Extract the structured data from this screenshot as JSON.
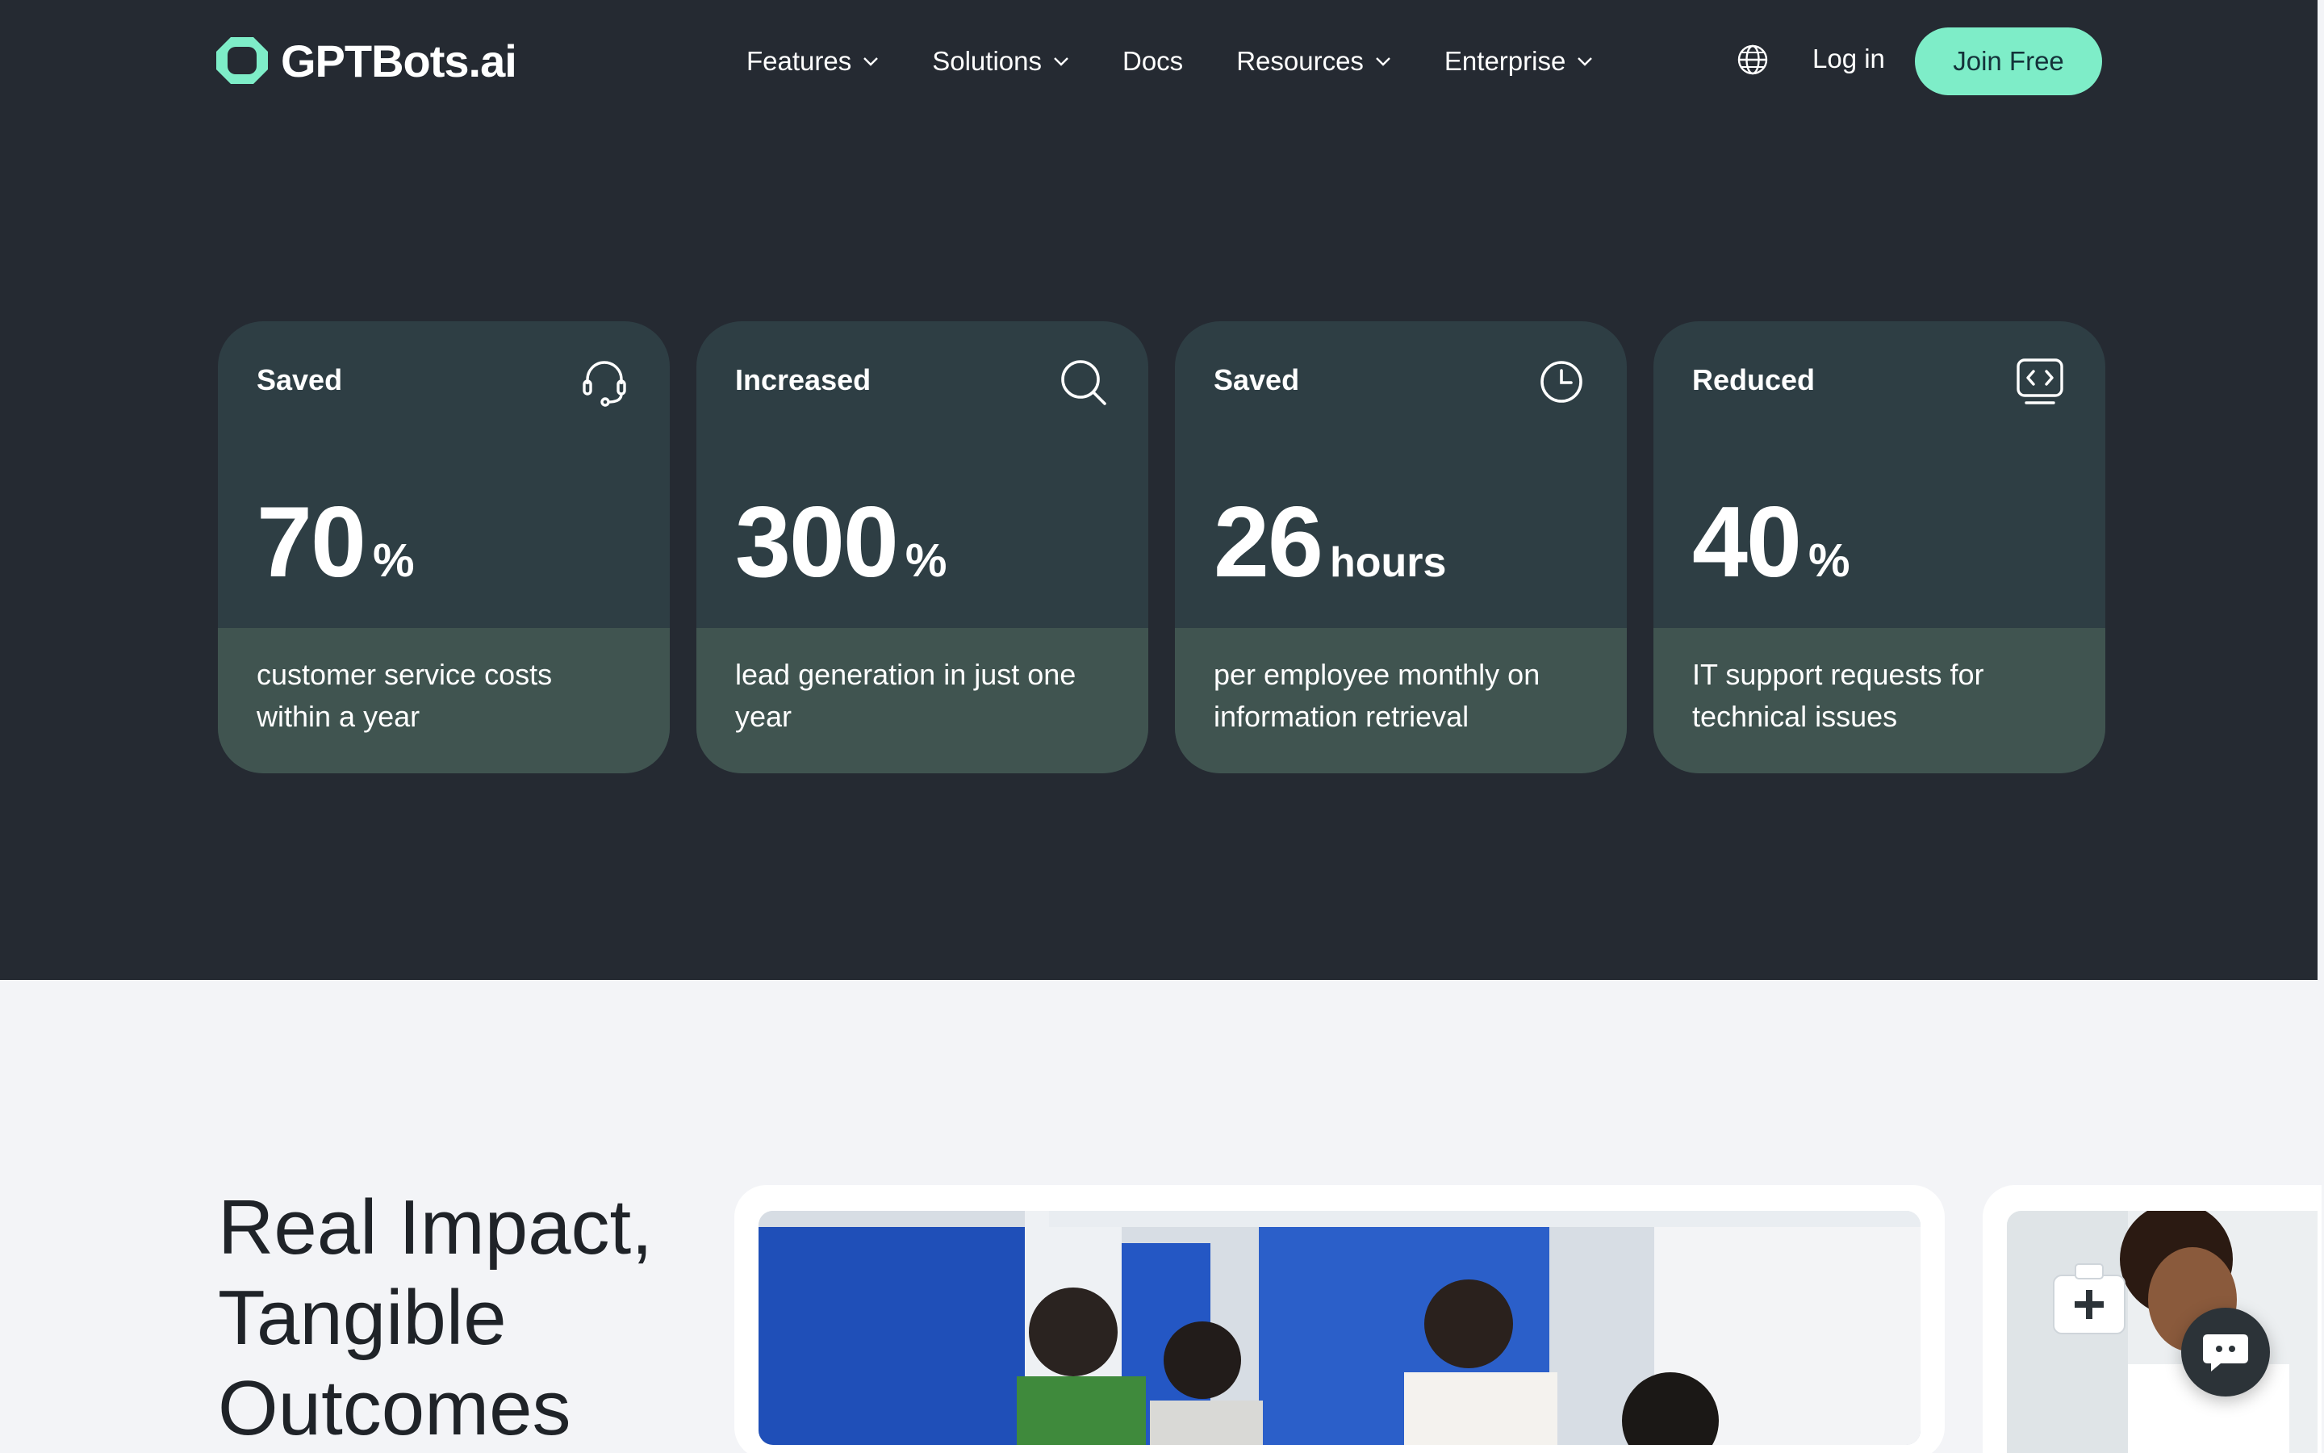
{
  "nav": {
    "logo_text": "GPTBots.ai",
    "items": [
      {
        "label": "Features",
        "has_dropdown": true
      },
      {
        "label": "Solutions",
        "has_dropdown": true
      },
      {
        "label": "Docs",
        "has_dropdown": false
      },
      {
        "label": "Resources",
        "has_dropdown": true
      },
      {
        "label": "Enterprise",
        "has_dropdown": true
      }
    ],
    "login_label": "Log in",
    "join_label": "Join Free",
    "language_icon": "globe-icon"
  },
  "stats": [
    {
      "label": "Saved",
      "icon": "headset-icon",
      "value": "70",
      "unit": "%",
      "description": "customer service costs within a year"
    },
    {
      "label": "Increased",
      "icon": "search-icon",
      "value": "300",
      "unit": "%",
      "description": "lead generation in just one year"
    },
    {
      "label": "Saved",
      "icon": "clock-icon",
      "value": "26",
      "unit": "hours",
      "description": "per employee monthly on information retrieval"
    },
    {
      "label": "Reduced",
      "icon": "code-monitor-icon",
      "value": "40",
      "unit": "%",
      "description": "IT support requests for technical issues"
    }
  ],
  "impact": {
    "heading": "Real Impact, Tangible Outcomes"
  },
  "colors": {
    "hero_bg": "#252a32",
    "card_top": "#2e3e44",
    "card_bottom": "#405450",
    "accent": "#7eedc8",
    "page_bg": "#f3f4f7"
  }
}
